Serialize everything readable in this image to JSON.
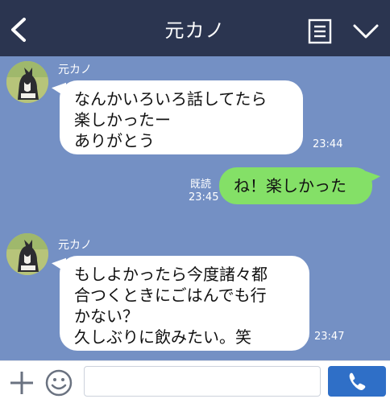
{
  "header": {
    "title": "元カノ",
    "back_icon": "chevron-left-icon",
    "menu_icon": "notes-icon",
    "dropdown_icon": "chevron-down-icon",
    "bg_color": "#2b3550"
  },
  "chat": {
    "bg_color": "#7490c4",
    "messages": [
      {
        "side": "left",
        "sender": "元カノ",
        "text": "なんかいろいろ話してたら\n楽しかったー\nありがとう",
        "time": "23:44"
      },
      {
        "side": "right",
        "read_label": "既読",
        "text": "ね！楽しかった",
        "time": "23:45"
      },
      {
        "side": "left",
        "sender": "元カノ",
        "text": "もしよかったら今度諸々都\n合つくときにごはんでも行\nかない？\n久しぶりに飲みたい。笑",
        "time": "23:47"
      }
    ]
  },
  "footer": {
    "plus_icon": "plus-icon",
    "sticker_icon": "smiley-icon",
    "input_value": "",
    "call_icon": "phone-icon",
    "call_color": "#2f6fc7"
  }
}
